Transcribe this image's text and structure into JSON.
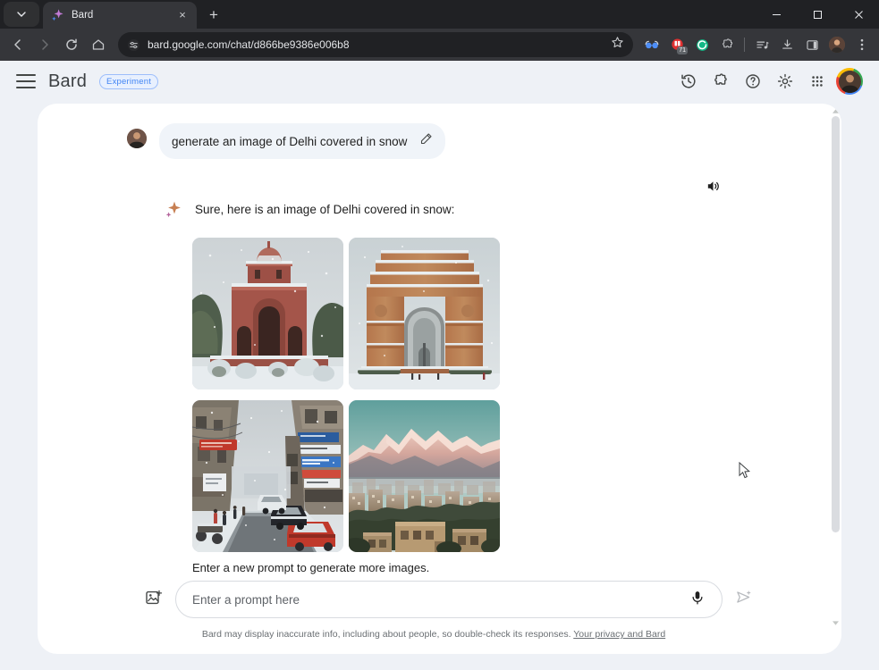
{
  "browser": {
    "tab": {
      "title": "Bard",
      "favicon": "bard-sparkle-icon",
      "close": "×"
    },
    "new_tab_label": "+",
    "tab_list_chevron": "⌄",
    "window_controls": {
      "minimize": "—",
      "maximize": "▢",
      "close": "✕"
    },
    "nav": {
      "back": "←",
      "forward": "→",
      "reload": "⟳",
      "home": "⌂"
    },
    "omnibox": {
      "url": "bard.google.com/chat/d866be9386e006b8",
      "site_settings_icon": "tune-icon",
      "bookmark_icon": "star-icon"
    },
    "extensions": [
      {
        "name": "glasses-extension-icon",
        "badge": ""
      },
      {
        "name": "red-tab-counter-extension-icon",
        "badge": "71"
      },
      {
        "name": "green-circle-extension-icon",
        "badge": ""
      },
      {
        "name": "puzzle-extensions-icon",
        "badge": ""
      },
      {
        "name": "reading-list-icon",
        "badge": ""
      },
      {
        "name": "downloads-icon",
        "badge": ""
      },
      {
        "name": "side-panel-icon",
        "badge": ""
      },
      {
        "name": "profile-avatar-icon",
        "badge": ""
      },
      {
        "name": "chrome-menu-icon",
        "badge": ""
      }
    ]
  },
  "app": {
    "menu_icon": "hamburger-menu-icon",
    "name": "Bard",
    "badge": "Experiment",
    "header_icons": [
      {
        "name": "activity-history-icon",
        "glyph": "history"
      },
      {
        "name": "extensions-icon",
        "glyph": "puzzle"
      },
      {
        "name": "help-icon",
        "glyph": "question"
      },
      {
        "name": "settings-icon",
        "glyph": "gear"
      },
      {
        "name": "google-apps-icon",
        "glyph": "grid"
      }
    ],
    "account_avatar": "user-account-avatar"
  },
  "conversation": {
    "user_prompt": "generate an image of Delhi covered in snow",
    "edit_icon": "pencil-edit-icon",
    "user_avatar": "user-avatar",
    "speaker_icon": "listen-speaker-icon",
    "bard_icon": "bard-sparkle-icon",
    "response_text": "Sure, here is an image of Delhi covered in snow:",
    "images": [
      {
        "alt": "Red sandstone mughal monument covered in snow",
        "name": "generated-image-1"
      },
      {
        "alt": "India Gate covered in snow",
        "name": "generated-image-2"
      },
      {
        "alt": "Snowy Delhi street with shops and cars",
        "name": "generated-image-3"
      },
      {
        "alt": "Delhi cityscape with snow-capped mountains at dusk",
        "name": "generated-image-4"
      }
    ],
    "grid_caption": "Enter a new prompt to generate more images."
  },
  "composer": {
    "add_image_icon": "add-image-icon",
    "placeholder": "Enter a prompt here",
    "value": "",
    "mic_icon": "microphone-icon",
    "send_icon": "send-icon"
  },
  "footer": {
    "disclaimer": "Bard may display inaccurate info, including about people, so double-check its responses.",
    "link": "Your privacy and Bard"
  },
  "colors": {
    "page_bg": "#eef1f6",
    "card_bg": "#ffffff",
    "accent_blue": "#4285f4",
    "badge_bg": "#e8f0fe",
    "bubble_bg": "#f0f4f9",
    "chrome_dark": "#202124",
    "toolbar_dark": "#35363a"
  }
}
